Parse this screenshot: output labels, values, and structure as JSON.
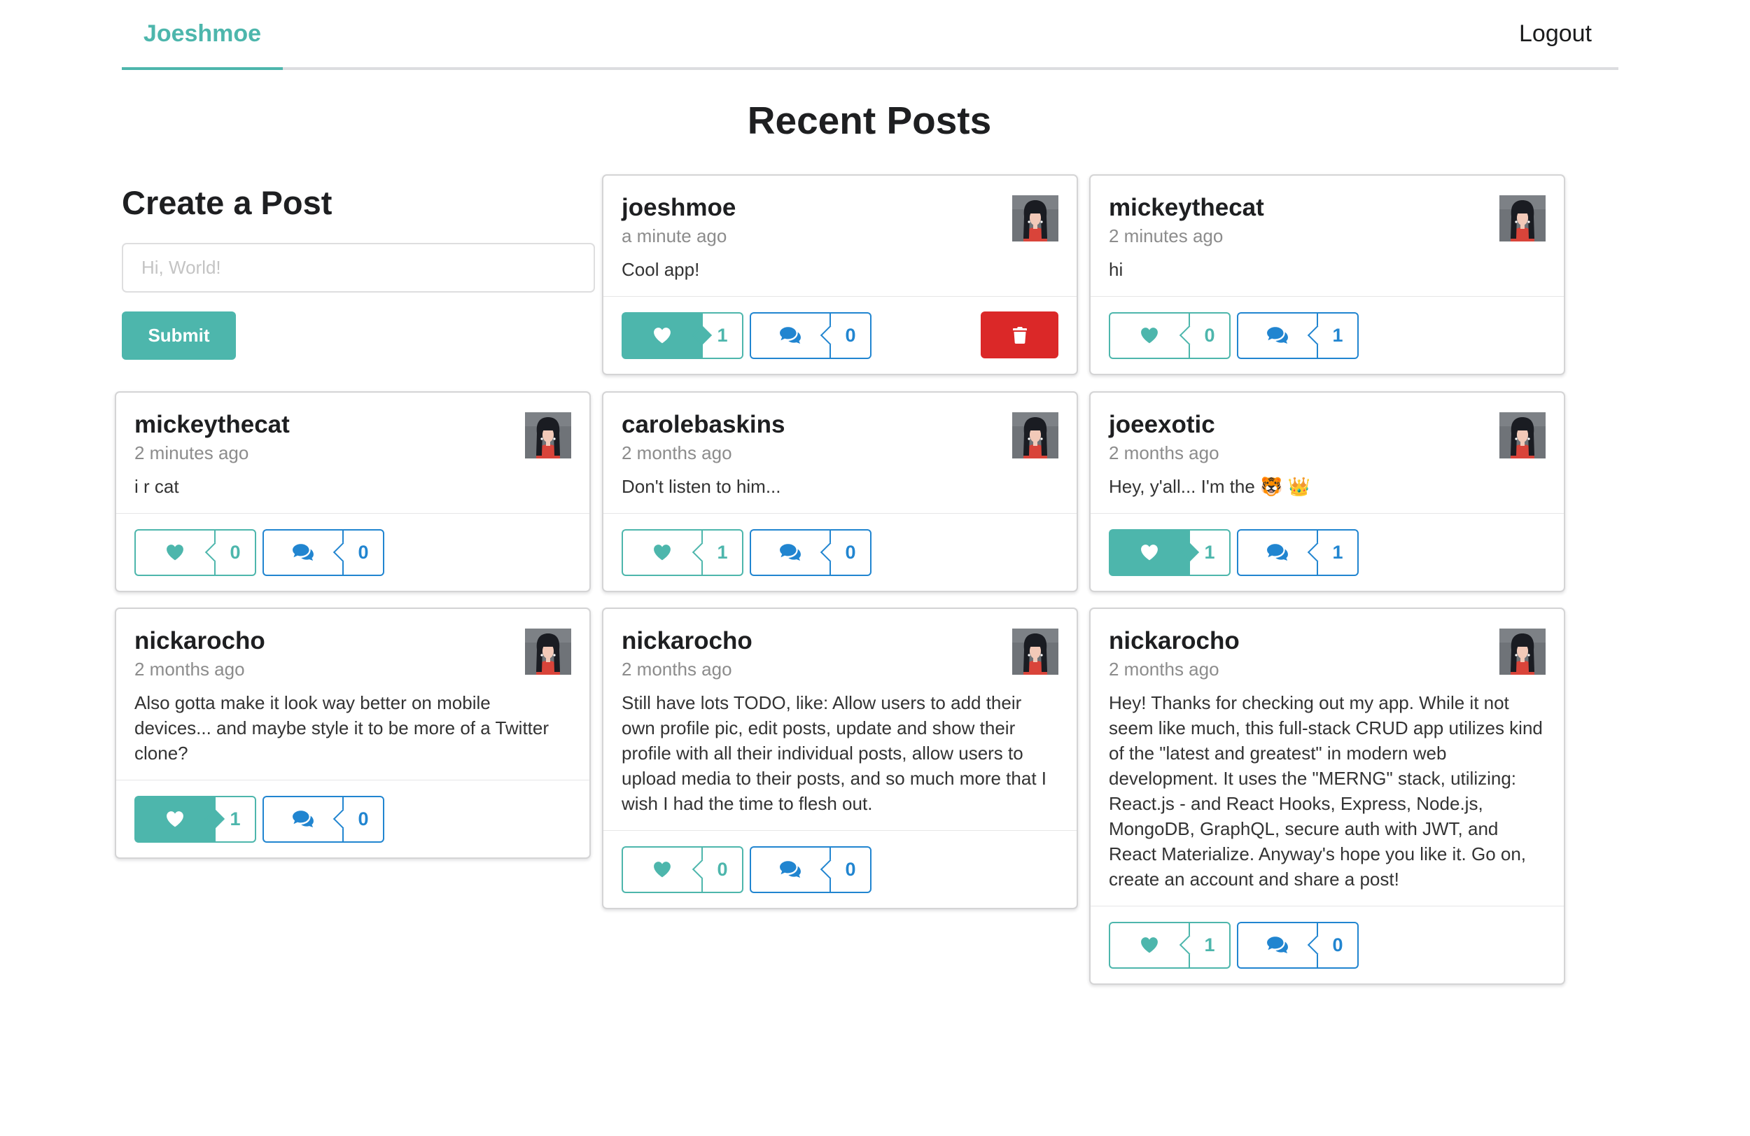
{
  "nav": {
    "brand": "Joeshmoe",
    "logout": "Logout"
  },
  "page_title": "Recent Posts",
  "create_post": {
    "title": "Create a Post",
    "placeholder": "Hi, World!",
    "submit": "Submit"
  },
  "colors": {
    "teal": "#4db6ac",
    "blue": "#2185d0",
    "red": "#db2828"
  },
  "icons": {
    "like": "heart-icon",
    "comment": "comments-icon",
    "delete": "trash-icon",
    "avatar": "avatar-image"
  },
  "posts": [
    {
      "user": "joeshmoe",
      "time": "a minute ago",
      "body": "Cool app!",
      "likes": "1",
      "comments": "0",
      "liked": true,
      "can_delete": true
    },
    {
      "user": "mickeythecat",
      "time": "2 minutes ago",
      "body": "hi",
      "likes": "0",
      "comments": "1",
      "liked": false,
      "can_delete": false
    },
    {
      "user": "mickeythecat",
      "time": "2 minutes ago",
      "body": "i r cat",
      "likes": "0",
      "comments": "0",
      "liked": false,
      "can_delete": false
    },
    {
      "user": "carolebaskins",
      "time": "2 months ago",
      "body": "Don't listen to him...",
      "likes": "1",
      "comments": "0",
      "liked": false,
      "can_delete": false
    },
    {
      "user": "joeexotic",
      "time": "2 months ago",
      "body": "Hey, y'all... I'm the 🐯 👑",
      "likes": "1",
      "comments": "1",
      "liked": true,
      "can_delete": false
    },
    {
      "user": "nickarocho",
      "time": "2 months ago",
      "body": "Also gotta make it look way better on mobile devices... and maybe style it to be more of a Twitter clone?",
      "likes": "1",
      "comments": "0",
      "liked": true,
      "can_delete": false
    },
    {
      "user": "nickarocho",
      "time": "2 months ago",
      "body": "Still have lots TODO, like: Allow users to add their own profile pic, edit posts, update and show their profile with all their individual posts, allow users to upload media to their posts, and so much more that I wish I had the time to flesh out.",
      "likes": "0",
      "comments": "0",
      "liked": false,
      "can_delete": false
    },
    {
      "user": "nickarocho",
      "time": "2 months ago",
      "body": "Hey! Thanks for checking out my app. While it not seem like much, this full-stack CRUD app utilizes kind of the \"latest and greatest\" in modern web development. It uses the \"MERNG\" stack, utilizing: React.js - and React Hooks, Express, Node.js, MongoDB, GraphQL, secure auth with JWT, and React Materialize. Anyway's hope you like it. Go on, create an account and share a post!",
      "likes": "1",
      "comments": "0",
      "liked": false,
      "can_delete": false
    }
  ]
}
